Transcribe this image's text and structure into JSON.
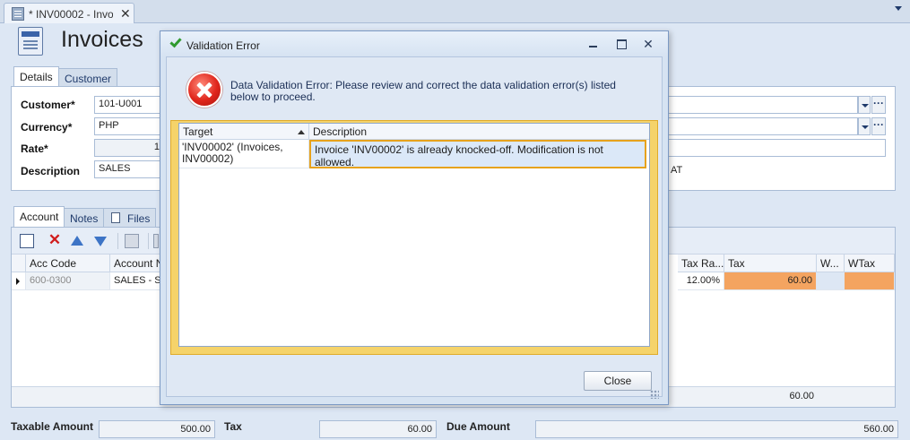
{
  "doc_tab": {
    "label": "* INV00002 - Invoi",
    "close": "✕"
  },
  "form": {
    "title": "Invoices",
    "top_tabs": [
      "Details",
      "Customer"
    ],
    "fields": {
      "customer_label": "Customer*",
      "customer_value": "101-U001",
      "currency_label": "Currency*",
      "currency_value": "PHP",
      "rate_label": "Rate*",
      "rate_value": "1",
      "description_label": "Description",
      "description_value": "SALES",
      "ellipsis": "···",
      "vat_fragment": "AT"
    },
    "bottom_tabs": [
      "Account",
      "Notes",
      "Files"
    ],
    "grid": {
      "columns": [
        "Acc Code",
        "Account Na",
        "Tax Ra...",
        "Tax",
        "W...",
        "WTax"
      ],
      "rows": [
        {
          "acc_code": "600-0300",
          "account_name": "SALES - SE",
          "tax_rate": "12.00%",
          "tax": "60.00",
          "w": "",
          "wtax": ""
        }
      ],
      "footer_tax": "60.00"
    },
    "totals": {
      "taxable_label": "Taxable Amount",
      "taxable_value": "500.00",
      "tax_label": "Tax",
      "tax_value": "60.00",
      "due_label": "Due Amount",
      "due_value": "560.00"
    }
  },
  "dialog": {
    "title": "Validation Error",
    "message": "Data Validation Error: Please review and correct the data validation error(s) listed below to proceed.",
    "columns": [
      "Target",
      "Description"
    ],
    "errors": [
      {
        "target": "'INV00002' (Invoices, INV00002)",
        "description": "Invoice 'INV00002' is already knocked-off. Modification is not allowed."
      }
    ],
    "close_label": "Close",
    "window_close": "✕"
  },
  "colors": {
    "accent": "#1f3a6b",
    "highlight_orange": "#f4a460",
    "error_frame": "#f5d36a",
    "error_border": "#e7a21c"
  },
  "icons": [
    "form-icon",
    "check-icon",
    "error-icon",
    "new-icon",
    "delete-icon",
    "move-up-icon",
    "move-down-icon",
    "copy-icon",
    "attach-icon"
  ]
}
